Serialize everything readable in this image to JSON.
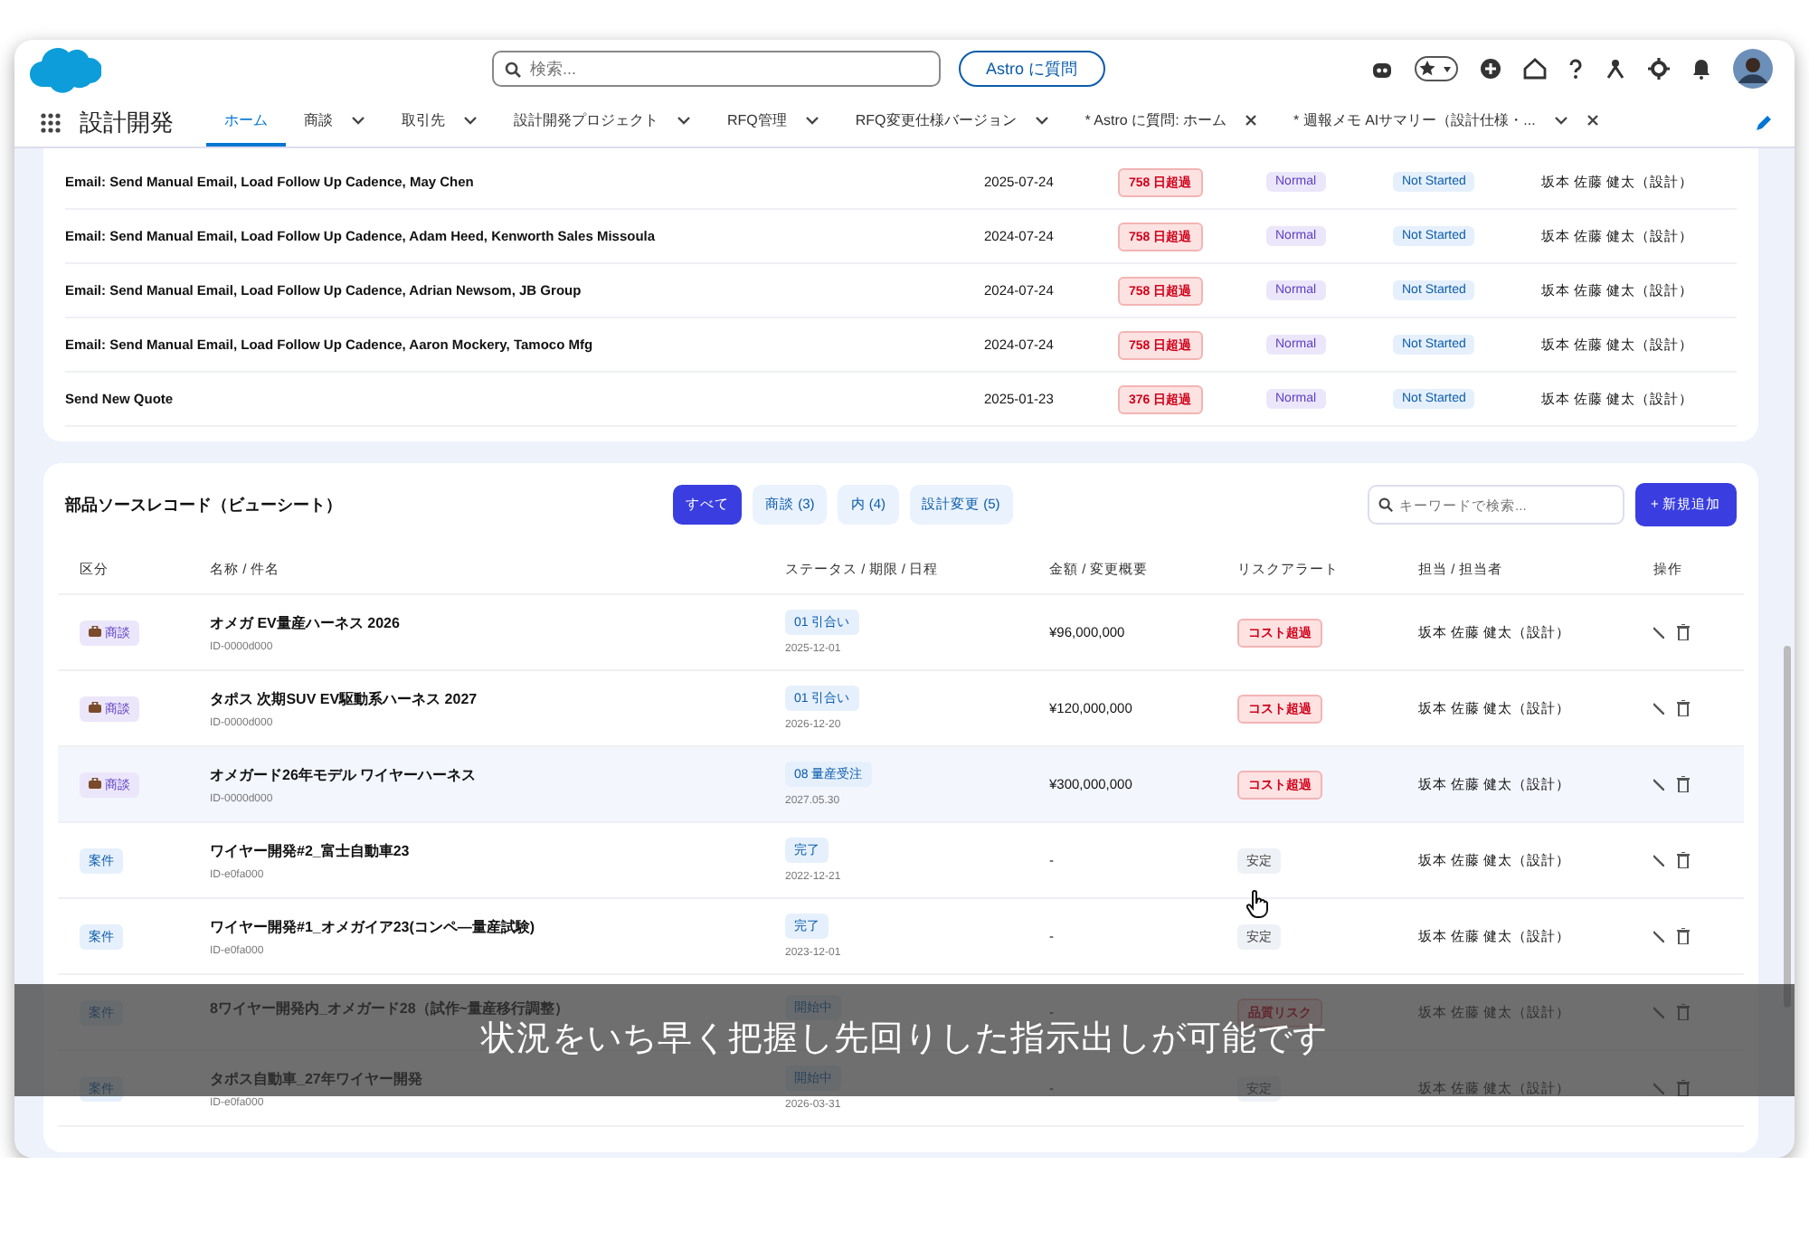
{
  "header": {
    "search": {
      "placeholder": "検索..."
    },
    "astro_button": "Astro に質問"
  },
  "nav": {
    "app_name": "設計開発",
    "tabs": [
      {
        "label": "ホーム",
        "selected": true,
        "menu": false,
        "closable": false
      },
      {
        "label": "商談",
        "selected": false,
        "menu": true,
        "closable": false
      },
      {
        "label": "取引先",
        "selected": false,
        "menu": true,
        "closable": false
      },
      {
        "label": "設計開発プロジェクト",
        "selected": false,
        "menu": true,
        "closable": false
      },
      {
        "label": "RFQ管理",
        "selected": false,
        "menu": true,
        "closable": false
      },
      {
        "label": "RFQ変更仕様バージョン",
        "selected": false,
        "menu": true,
        "closable": false
      },
      {
        "label": "* Astro に質問: ホーム",
        "selected": false,
        "menu": false,
        "closable": true
      },
      {
        "label": "* 週報メモ AIサマリー（設計仕様・...",
        "selected": false,
        "menu": true,
        "closable": true
      }
    ]
  },
  "tasks": [
    {
      "subject": "Email: Send Manual Email, Load Follow Up Cadence, May Chen",
      "date": "2025-07-24",
      "overdue": "758 日超過",
      "priority": "Normal",
      "status": "Not Started",
      "owner": "坂本 佐藤 健太（設計）"
    },
    {
      "subject": "Email: Send Manual Email, Load Follow Up Cadence, Adam Heed, Kenworth Sales Missoula",
      "date": "2024-07-24",
      "overdue": "758 日超過",
      "priority": "Normal",
      "status": "Not Started",
      "owner": "坂本 佐藤 健太（設計）"
    },
    {
      "subject": "Email: Send Manual Email, Load Follow Up Cadence, Adrian Newsom, JB Group",
      "date": "2024-07-24",
      "overdue": "758 日超過",
      "priority": "Normal",
      "status": "Not Started",
      "owner": "坂本 佐藤 健太（設計）"
    },
    {
      "subject": "Email: Send Manual Email, Load Follow Up Cadence, Aaron Mockery, Tamoco Mfg",
      "date": "2024-07-24",
      "overdue": "758 日超過",
      "priority": "Normal",
      "status": "Not Started",
      "owner": "坂本 佐藤 健太（設計）"
    },
    {
      "subject": "Send New Quote",
      "date": "2025-01-23",
      "overdue": "376 日超過",
      "priority": "Normal",
      "status": "Not Started",
      "owner": "坂本 佐藤 健太（設計）"
    }
  ],
  "records": {
    "title": "部品ソースレコード（ビューシート）",
    "filters": [
      {
        "label": "すべて",
        "selected": true
      },
      {
        "label": "商談 (3)",
        "selected": false
      },
      {
        "label": "内 (4)",
        "selected": false
      },
      {
        "label": "設計変更 (5)",
        "selected": false
      }
    ],
    "search": {
      "placeholder": "キーワードで検索..."
    },
    "add_button": "+ 新規追加",
    "columns": [
      "区分",
      "名称 / 件名",
      "ステータス / 期限 / 日程",
      "金額 / 変更概要",
      "リスクアラート",
      "担当 / 担当者",
      "操作"
    ],
    "rows": [
      {
        "kind": "deal",
        "category": "商談",
        "name": "オメガ EV量産ハーネス 2026",
        "id": "ID-0000d000",
        "status": "01 引合い",
        "date": "2025-12-01",
        "amount": "¥96,000,000",
        "risk": {
          "text": "コスト超過",
          "kind": "danger"
        },
        "owner": "坂本 佐藤 健太（設計）",
        "selected": false
      },
      {
        "kind": "deal",
        "category": "商談",
        "name": "タポス 次期SUV EV駆動系ハーネス 2027",
        "id": "ID-0000d000",
        "status": "01 引合い",
        "date": "2026-12-20",
        "amount": "¥120,000,000",
        "risk": {
          "text": "コスト超過",
          "kind": "danger"
        },
        "owner": "坂本 佐藤 健太（設計）",
        "selected": false
      },
      {
        "kind": "deal",
        "category": "商談",
        "name": "オメガード26年モデル ワイヤーハーネス",
        "id": "ID-0000d000",
        "status": "08 量産受注",
        "date": "2027.05.30",
        "amount": "¥300,000,000",
        "risk": {
          "text": "コスト超過",
          "kind": "danger"
        },
        "owner": "坂本 佐藤 健太（設計）",
        "selected": true
      },
      {
        "kind": "project",
        "category": "案件",
        "name": "ワイヤー開発#2_富士自動車23",
        "id": "ID-e0fa000",
        "status": "完了",
        "date": "2022-12-21",
        "amount": "-",
        "risk": {
          "text": "安定",
          "kind": "stable"
        },
        "owner": "坂本 佐藤 健太（設計）",
        "selected": false
      },
      {
        "kind": "project",
        "category": "案件",
        "name": "ワイヤー開発#1_オメガイア23(コンペ―量産試験)",
        "id": "ID-e0fa000",
        "status": "完了",
        "date": "2023-12-01",
        "amount": "-",
        "risk": {
          "text": "安定",
          "kind": "stable"
        },
        "owner": "坂本 佐藤 健太（設計）",
        "selected": false
      },
      {
        "kind": "project",
        "category": "案件",
        "name": "8ワイヤー開発内_オメガード28（試作~量産移行調整）",
        "status": "開始中",
        "amount": "-",
        "risk": {
          "text": "品質リスク",
          "kind": "danger"
        },
        "owner": "坂本 佐藤 健太（設計）",
        "selected": false
      },
      {
        "kind": "project",
        "category": "案件",
        "name": "タポス自動車_27年ワイヤー開発",
        "id": "ID-e0fa000",
        "status": "開始中",
        "date": "2026-03-31",
        "amount": "-",
        "risk": {
          "text": "安定",
          "kind": "stable"
        },
        "owner": "坂本 佐藤 健太（設計）",
        "selected": false
      }
    ]
  },
  "subtitle": "状況をいち早く把握し先回りした指示出しが可能です"
}
